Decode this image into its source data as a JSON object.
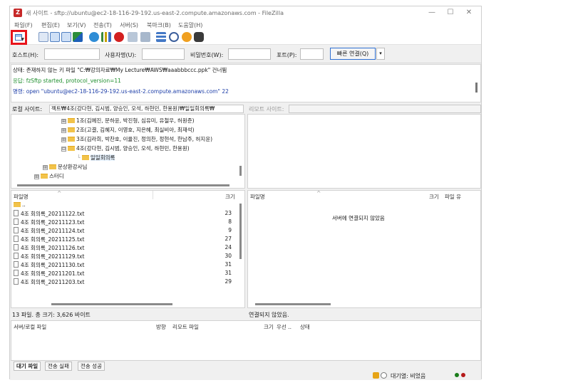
{
  "window": {
    "title": "새 사이트 - sftp://ubuntu@ec2-18-116-29-192.us-east-2.compute.amazonaws.com - FileZilla",
    "controls": [
      "—",
      "☐",
      "✕"
    ]
  },
  "menu": [
    "파일(F)",
    "편집(E)",
    "보기(V)",
    "전송(T)",
    "서버(S)",
    "북마크(B)",
    "도움말(H)"
  ],
  "quickconnect": {
    "host_label": "호스트(H):",
    "user_label": "사용자명(U):",
    "pass_label": "비밀번호(W):",
    "port_label": "포트(P):",
    "connect_button": "빠른 연결(Q)",
    "dropdown_glyph": "▾"
  },
  "log": [
    {
      "text": "상태: 존재하지 않는 키 파일 \"C:₩강의자료₩My Lecture₩AWS₩aaabbbccc.ppk\" 건너뜀",
      "color": "#1a1a1a"
    },
    {
      "text": "응답: fzSftp started, protocol_version=11",
      "color": "#1f8f2e"
    },
    {
      "text": "명령: open \"ubuntu@ec2-18-116-29-192.us-east-2.compute.amazonaws.com\" 22",
      "color": "#1d3ea8"
    }
  ],
  "local_site": {
    "label": "로컬 사이트:",
    "path": "젝트₩4조(강다현, 김시범, 양승인, 오석, 하현민, 한용원)₩일일회의록₩",
    "tree": [
      {
        "label": "1조(김예진, 문하윤, 박진형, 심유미, 유철우, 허원준)",
        "expander": "⊞",
        "indent": 70
      },
      {
        "label": "2조(고결, 김혜지, 이영호, 지은혜, 최실비아, 최재석)",
        "expander": "⊞",
        "indent": 70
      },
      {
        "label": "3조(김라희, 박찬호, 이율진, 정의찬, 정현석, 한남주, 허지윤)",
        "expander": "⊞",
        "indent": 70
      },
      {
        "label": "4조(강다현, 김시범, 양승인, 오석, 하현민, 한용원)",
        "expander": "⊟",
        "indent": 70
      },
      {
        "label": "일일회의록",
        "expander": "",
        "indent": 92
      },
      {
        "label": "문상환강사님",
        "expander": "⊞",
        "indent": 44
      },
      {
        "label": "스터디",
        "expander": "⊞",
        "indent": 32
      }
    ]
  },
  "remote_site": {
    "label": "리모트 사이트:",
    "path": ""
  },
  "local_files": {
    "columns": [
      "파일명",
      "크기"
    ],
    "parent": "..",
    "rows": [
      {
        "name": "4조 회의록_20211122.txt",
        "size": "23"
      },
      {
        "name": "4조 회의록_20211123.txt",
        "size": "8"
      },
      {
        "name": "4조 회의록_20211124.txt",
        "size": "9"
      },
      {
        "name": "4조 회의록_20211125.txt",
        "size": "27"
      },
      {
        "name": "4조 회의록_20211126.txt",
        "size": "24"
      },
      {
        "name": "4조 회의록_20211129.txt",
        "size": "30"
      },
      {
        "name": "4조 회의록_20211130.txt",
        "size": "31"
      },
      {
        "name": "4조 회의록_20211201.txt",
        "size": "31"
      },
      {
        "name": "4조 회의록_20211203.txt",
        "size": "29"
      }
    ],
    "status": "13 파일. 총 크기: 3,626 바이트"
  },
  "remote_files": {
    "columns": [
      "파일명",
      "크기",
      "파일 유"
    ],
    "message": "서버에 연결되지 않았음",
    "status": "연결되지 않았음."
  },
  "queue": {
    "columns": [
      "서버/로컬 파일",
      "방향",
      "리모트 파일",
      "크기",
      "우선 ..",
      "상태"
    ],
    "tabs": [
      "대기 파일",
      "전송 실패",
      "전송 성공"
    ]
  },
  "statusbar": {
    "queue_text": "대기열: 비었음"
  },
  "colors": {
    "highlight": "#e8141b",
    "accent": "#2f6fd1"
  },
  "icons": [
    "site-manager-icon",
    "toggle-log-icon",
    "toggle-local-tree-icon",
    "toggle-remote-tree-icon",
    "toggle-queue-icon",
    "refresh-icon",
    "process-queue-icon",
    "cancel-icon",
    "disconnect-icon",
    "reconnect-icon",
    "filter-icon",
    "compare-icon",
    "sync-browse-icon",
    "search-icon"
  ]
}
